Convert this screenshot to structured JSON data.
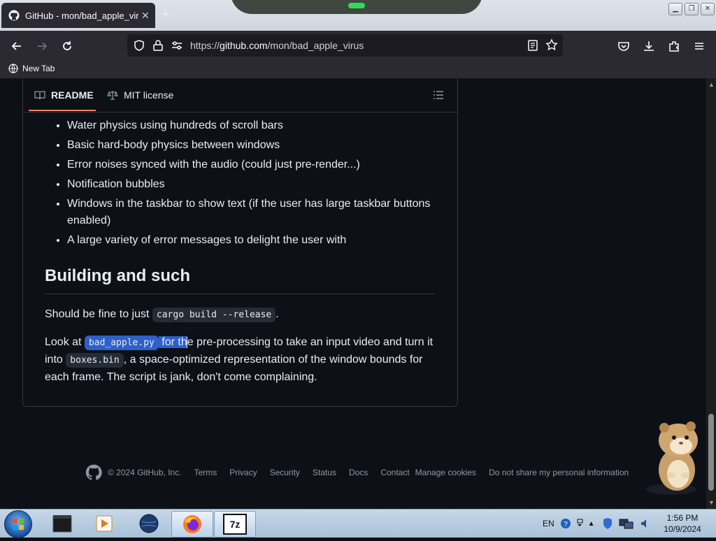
{
  "browser": {
    "tab_title": "GitHub - mon/bad_apple_virus",
    "tab_close": "✕",
    "new_tab_plus": "+",
    "url_prefix": "https://",
    "url_host": "github.com",
    "url_path": "/mon/bad_apple_virus",
    "bookmark_label": "New Tab"
  },
  "readme": {
    "tabs": [
      {
        "label": "README"
      },
      {
        "label": "MIT license"
      }
    ],
    "features": [
      "Water physics using hundreds of scroll bars",
      "Basic hard-body physics between windows",
      "Error noises synced with the audio (could just pre-render...)",
      "Notification bubbles",
      "Windows in the taskbar to show text (if the user has large taskbar buttons enabled)",
      "A large variety of error messages to delight the user with"
    ],
    "heading": "Building and such",
    "para1_before": "Should be fine to just ",
    "para1_code": "cargo build --release",
    "para1_after": ".",
    "para2_lookat": "Look at ",
    "para2_code1": "bad_apple.py",
    "para2_sel_text": " for th",
    "para2_rest1": "e pre-processing to take an input video and turn it into ",
    "para2_code2": "boxes.bin",
    "para2_rest2": ", a space-optimized representation of the window bounds for each frame. The script is jank, don't come complaining."
  },
  "footer": {
    "copyright": "© 2024 GitHub, Inc.",
    "links": [
      "Terms",
      "Privacy",
      "Security",
      "Status",
      "Docs",
      "Contact",
      "Manage cookies",
      "Do not share my personal information"
    ]
  },
  "taskbar": {
    "lang": "EN",
    "time": "1:56 PM",
    "date": "10/9/2024",
    "app_7zip_label": "7z"
  },
  "colors": {
    "page_bg": "#0d1117",
    "accent_underline": "#f78166",
    "selection": "#2d60c8"
  }
}
